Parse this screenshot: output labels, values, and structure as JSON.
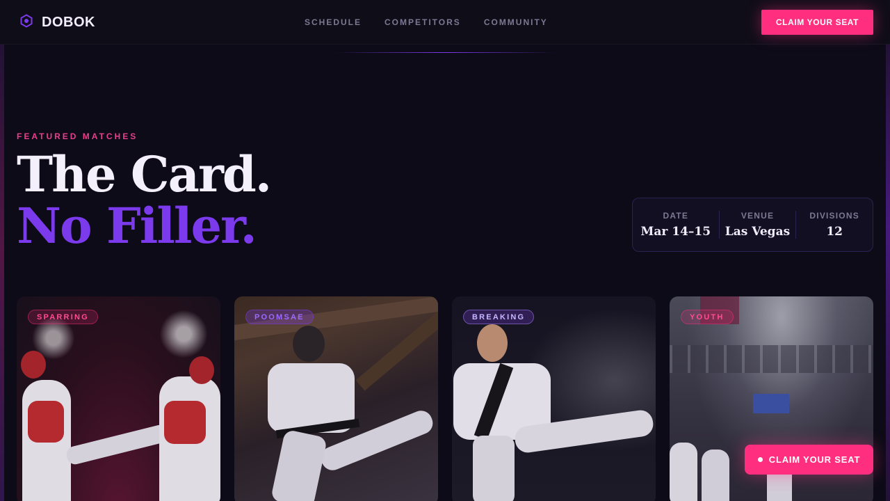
{
  "brand": {
    "name": "DOBOK",
    "logo_icon": "hex-logo-icon"
  },
  "nav": {
    "links": [
      "SCHEDULE",
      "COMPETITORS",
      "COMMUNITY"
    ],
    "cta_label": "CLAIM YOUR SEAT"
  },
  "hero": {
    "eyebrow": "FEATURED MATCHES",
    "title_line1": "The Card.",
    "title_line2": "No Filler."
  },
  "stats": [
    {
      "label": "DATE",
      "value": "Mar 14–15"
    },
    {
      "label": "VENUE",
      "value": "Las Vegas"
    },
    {
      "label": "DIVISIONS",
      "value": "12"
    }
  ],
  "cards": [
    {
      "tag": "SPARRING"
    },
    {
      "tag": "POOMSAE"
    },
    {
      "tag": "BREAKING"
    },
    {
      "tag": "YOUTH"
    }
  ],
  "floating_cta": {
    "label": "CLAIM YOUR SEAT"
  },
  "colors": {
    "accent_pink": "#ff2e7e",
    "accent_purple": "#7c3aed",
    "background": "#0d0b17"
  }
}
